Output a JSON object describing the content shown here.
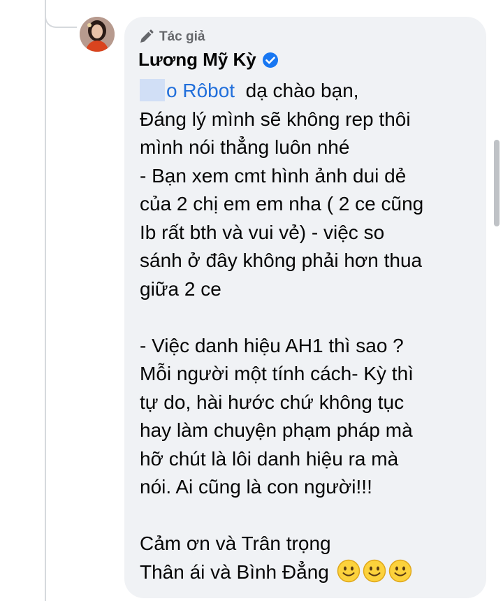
{
  "comment": {
    "badge_label": "Tác giả",
    "author_name": "Lương Mỹ Kỳ",
    "mention": "o Rôbot",
    "first_line_rest": "  dạ chào bạn,",
    "lines": [
      "Đáng lý mình sẽ không rep thôi",
      "mình nói thẳng luôn nhé",
      "- Bạn xem cmt hình ảnh dui dẻ",
      "của 2 chị em em nha ( 2 ce cũng",
      "Ib rất bth và vui vẻ) - việc so",
      "sánh ở đây không phải hơn thua",
      "giữa 2 ce",
      "",
      "- Việc danh hiệu AH1 thì sao ?",
      "Mỗi người một tính cách- Kỳ thì",
      "tự do, hài hước chứ không tục",
      "hay làm chuyện phạm pháp mà",
      "hỡ chút là lôi danh hiệu ra mà",
      "nói. Ai cũng là con người!!!",
      "",
      "Cảm ơn và Trân trọng"
    ],
    "last_line": "Thân ái và Bình Đẳng",
    "emoji_icon": "slightly-smiling-face-emoji",
    "colors": {
      "bubble": "#f0f2f5",
      "mention": "#216fdb",
      "verified": "#1877f2",
      "badge_text": "#65676b"
    }
  }
}
